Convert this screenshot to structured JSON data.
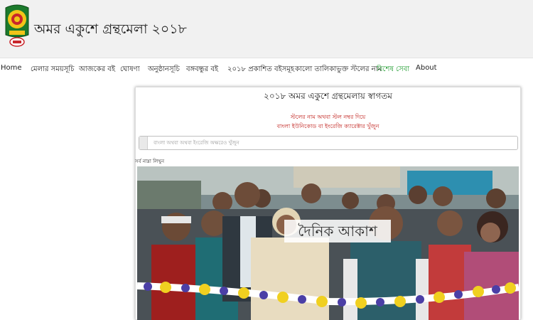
{
  "header": {
    "site_title": "অমর একুশে গ্রন্থমেলা ২০১৮",
    "logo_icon": "fair-emblem-icon"
  },
  "nav": {
    "items": [
      {
        "label": "Home"
      },
      {
        "label": "মেলার সময়সূচি"
      },
      {
        "label": "আজকের বই"
      },
      {
        "label": "ঘোষণা"
      },
      {
        "label": "অনুষ্ঠানসূচি"
      },
      {
        "label": "বঙ্গবন্ধুর বই"
      },
      {
        "label": "২০১৮ প্রকাশিত বইসমূহ"
      },
      {
        "label": "কালো তালিকাভুক্ত স্টলের নাম"
      },
      {
        "label": "বিশেষ সেবা"
      },
      {
        "label": "About"
      }
    ],
    "special_color": "#1a9a2a"
  },
  "main": {
    "welcome": "২০১৮ অমর একুশে গ্রন্থমেলায় স্বাগতম",
    "hint_line1": "স্টলের নাম অথবা স্টল নম্বর দিয়ে",
    "hint_line2": "বাংলা ইউনিকোড বা ইংরেজি ক্যারেক্টার খুঁজুন",
    "search_placeholder": "বাংলা অথবা অথবা ইংরেজি অক্ষরেও খুঁজুন",
    "recent_label": "সর্ব নাম্না লিখুন",
    "hint_color": "#c0201c"
  },
  "photo": {
    "watermark": "দৈনিক আকাশ"
  }
}
